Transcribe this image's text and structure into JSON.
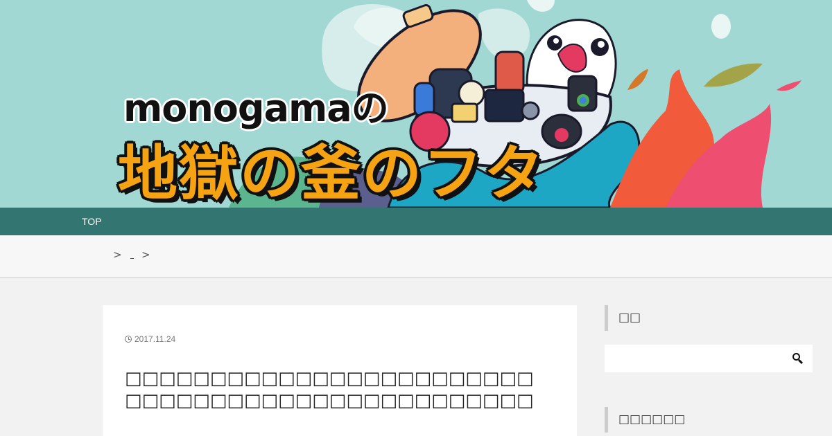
{
  "header": {
    "logo_top": "monogamaの",
    "logo_main": "地獄の釜のフタ",
    "colors": {
      "banner_bg": "#a2d8d4",
      "logo_orange": "#f6a313"
    }
  },
  "nav": {
    "items": [
      {
        "label": "TOP"
      }
    ],
    "background": "#337671"
  },
  "breadcrumb": {
    "sep1": ">",
    "sep2": ">"
  },
  "article": {
    "date": "2017.11.24",
    "title": "□□□□□□□□□□□□□□□□□□□□□□□□□□□□□□□□□□□□□□□□□□□□□□□□"
  },
  "sidebar": {
    "search_title": "□□",
    "search_placeholder": "",
    "widget2_title": "□□□□□□"
  },
  "icons": {
    "date": "clock-icon",
    "search": "search-icon"
  }
}
